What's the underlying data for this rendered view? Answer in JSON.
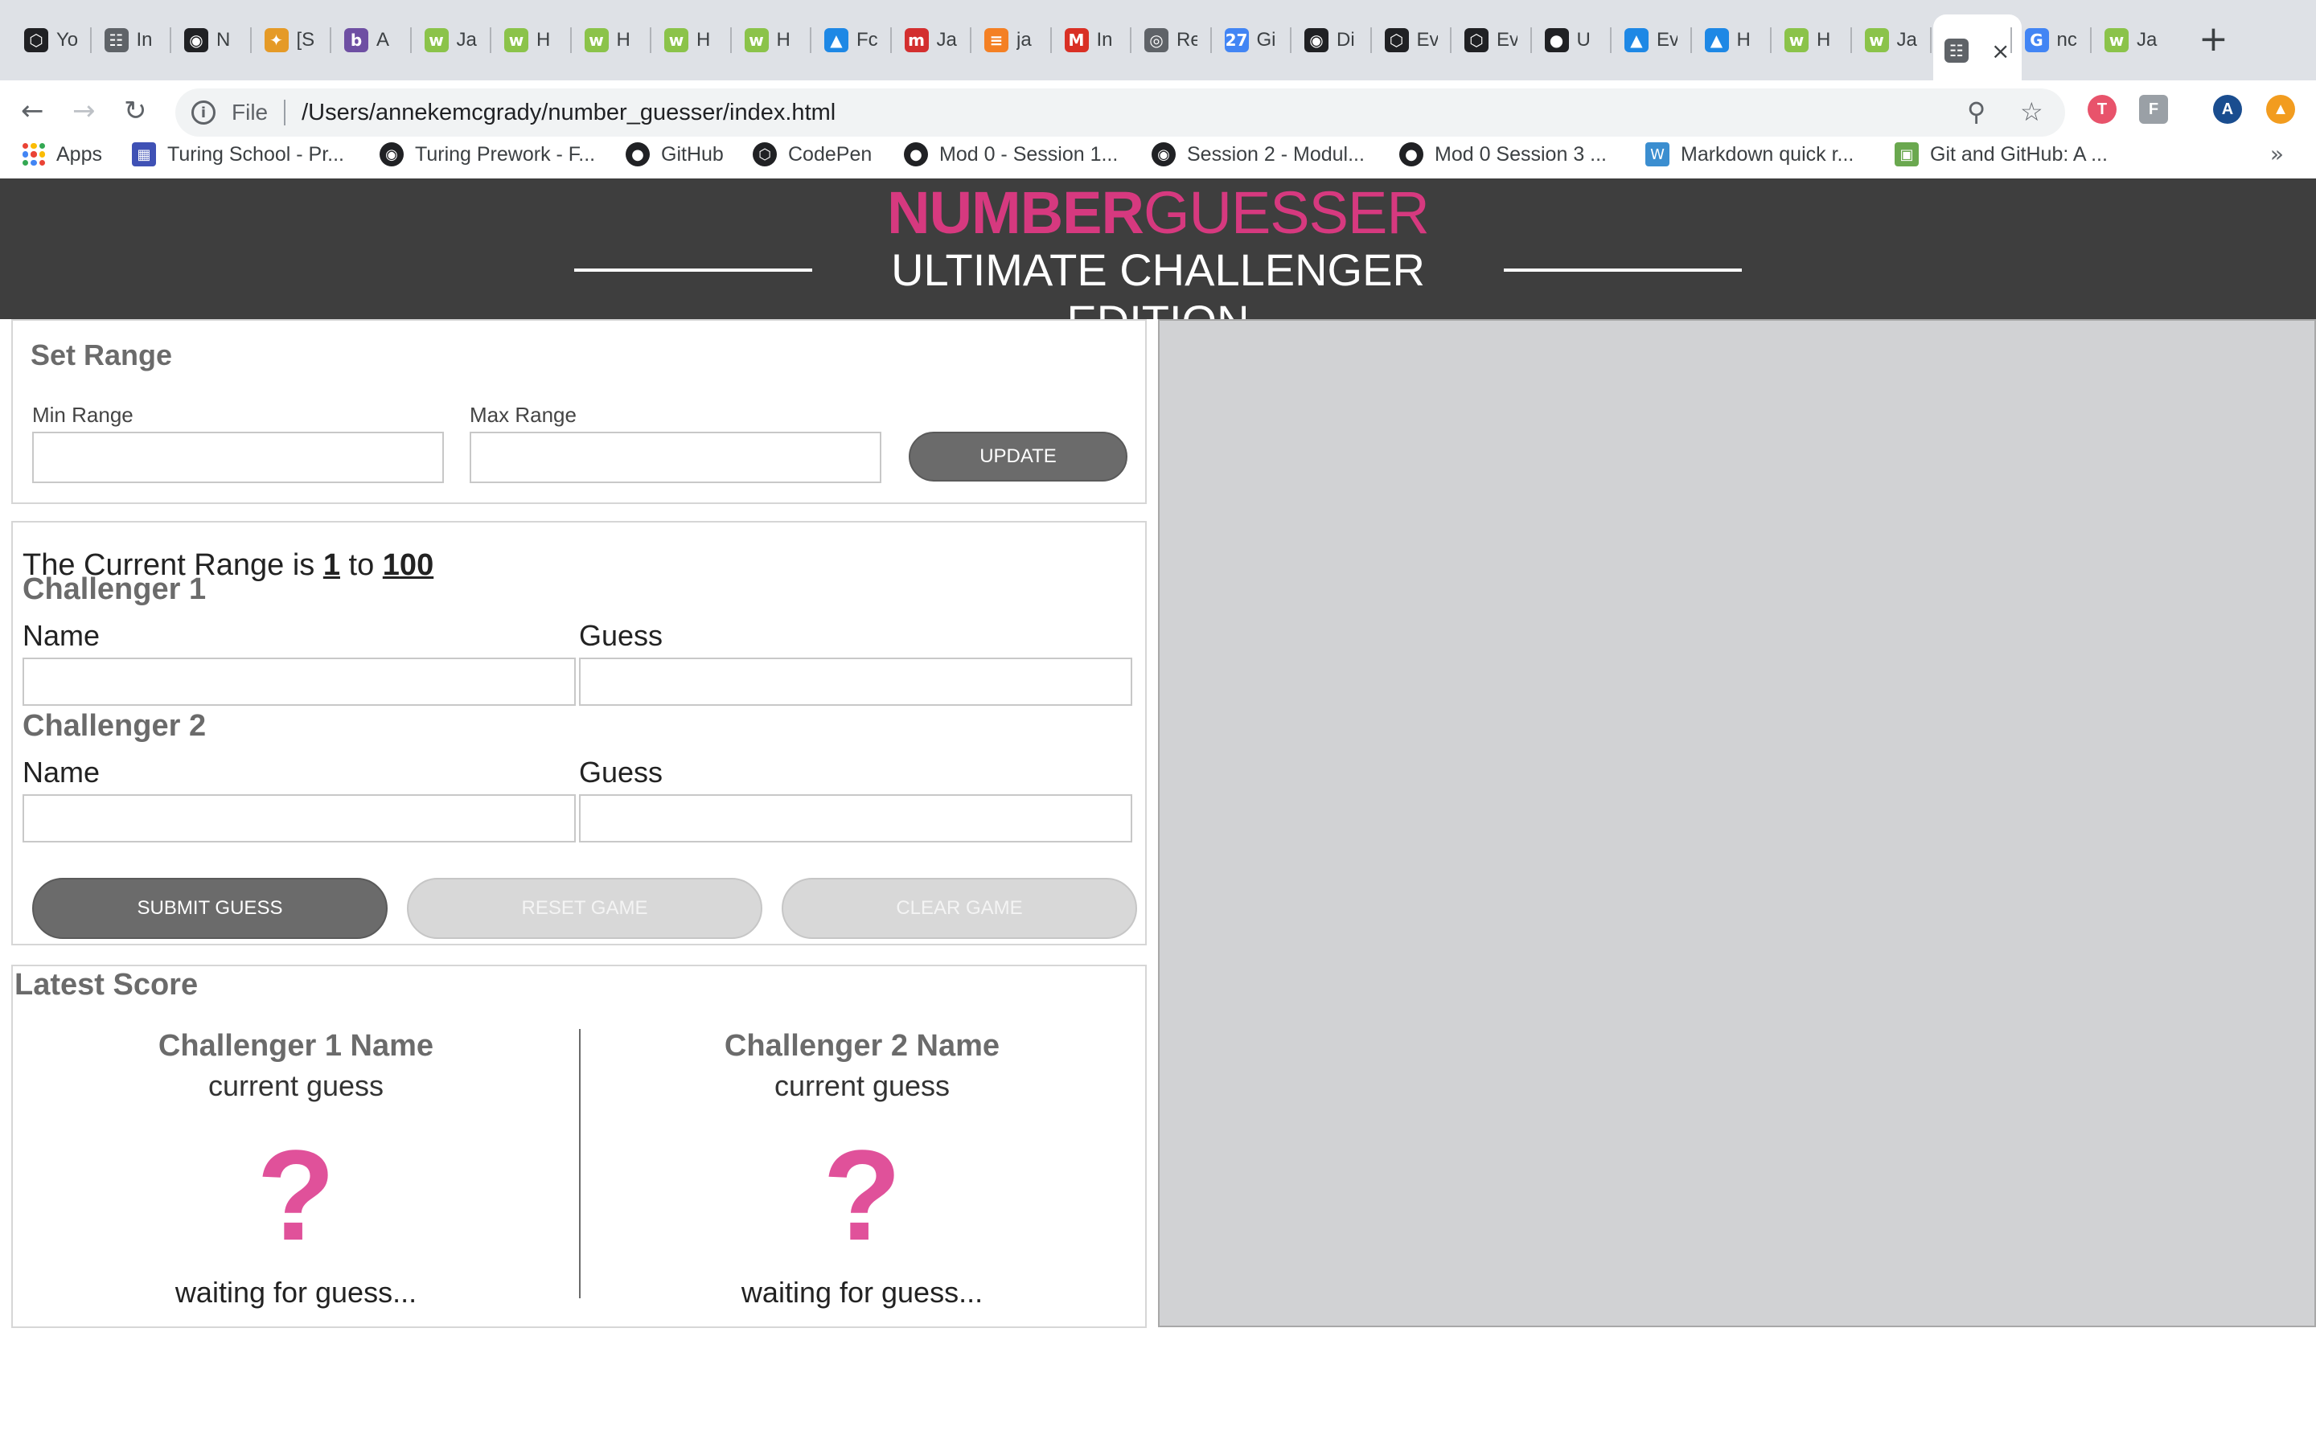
{
  "browser": {
    "tabs": [
      {
        "title": "Yo",
        "icon": "codepen-icon",
        "color": "#202124"
      },
      {
        "title": "In",
        "icon": "document-icon",
        "color": "#5f6368"
      },
      {
        "title": "N",
        "icon": "turing-icon",
        "color": "#202124"
      },
      {
        "title": "[S",
        "icon": "slack-icon",
        "color": "#e59a27"
      },
      {
        "title": "A",
        "icon": "bit-icon",
        "color": "#6e4fa3"
      },
      {
        "title": "Ja",
        "icon": "w3-icon",
        "color": "#8bc34a"
      },
      {
        "title": "H",
        "icon": "w3-icon",
        "color": "#8bc34a"
      },
      {
        "title": "H",
        "icon": "w3-icon",
        "color": "#8bc34a"
      },
      {
        "title": "H",
        "icon": "w3-icon",
        "color": "#8bc34a"
      },
      {
        "title": "H",
        "icon": "w3-icon",
        "color": "#8bc34a"
      },
      {
        "title": "Fc",
        "icon": "bird-icon",
        "color": "#1e88e5"
      },
      {
        "title": "Ja",
        "icon": "mozilla-icon",
        "color": "#d32f2f"
      },
      {
        "title": "ja",
        "icon": "stackoverflow-icon",
        "color": "#f48024"
      },
      {
        "title": "In",
        "icon": "gmail-icon",
        "color": "#d93025"
      },
      {
        "title": "Re",
        "icon": "spiral-icon",
        "color": "#5f6368"
      },
      {
        "title": "Gi",
        "icon": "calendar-icon",
        "color": "#4285f4"
      },
      {
        "title": "Di",
        "icon": "turing-icon",
        "color": "#202124"
      },
      {
        "title": "Ev",
        "icon": "codepen-icon",
        "color": "#202124"
      },
      {
        "title": "Ev",
        "icon": "codepen-icon",
        "color": "#202124"
      },
      {
        "title": "U",
        "icon": "github-icon",
        "color": "#202124"
      },
      {
        "title": "Ev",
        "icon": "bird-icon",
        "color": "#1e88e5"
      },
      {
        "title": "H",
        "icon": "bird-icon",
        "color": "#1e88e5"
      },
      {
        "title": "H",
        "icon": "w3-icon",
        "color": "#8bc34a"
      },
      {
        "title": "Ja",
        "icon": "w3-icon",
        "color": "#8bc34a"
      },
      {
        "title": "",
        "icon": "document-icon",
        "color": "#5f6368",
        "active": true
      },
      {
        "title": "nc",
        "icon": "google-icon",
        "color": "#4285f4"
      },
      {
        "title": "Ja",
        "icon": "w3-icon",
        "color": "#8bc34a"
      }
    ],
    "address": {
      "scheme": "File",
      "url": "/Users/annekemcgrady/number_guesser/index.html"
    },
    "bookmarks": [
      {
        "label": "Apps",
        "icon": "apps-grid-icon"
      },
      {
        "label": "Turing School - Pr...",
        "icon": "turing-school-icon"
      },
      {
        "label": "Turing Prework - F...",
        "icon": "turing-icon"
      },
      {
        "label": "GitHub",
        "icon": "github-icon"
      },
      {
        "label": "CodePen",
        "icon": "codepen-icon"
      },
      {
        "label": "Mod 0 - Session 1...",
        "icon": "github-icon"
      },
      {
        "label": "Session 2 - Modul...",
        "icon": "turing-icon"
      },
      {
        "label": "Mod 0 Session 3 ...",
        "icon": "github-icon"
      },
      {
        "label": "Markdown quick r...",
        "icon": "wordpress-icon"
      },
      {
        "label": "Git and GitHub: A ...",
        "icon": "image-icon"
      }
    ],
    "bookmarks_more": "»",
    "profile_initial": "A"
  },
  "header": {
    "logo_bold": "NUMBER",
    "logo_thin": "GUESSER",
    "edition": "ULTIMATE CHALLENGER EDITION"
  },
  "set_range": {
    "title": "Set Range",
    "min_label": "Min Range",
    "max_label": "Max Range",
    "min_value": "",
    "max_value": "",
    "update_button": "UPDATE"
  },
  "challengers": {
    "range_prefix": "The Current Range is ",
    "range_min": "1",
    "range_joiner": " to ",
    "range_max": "100",
    "c1_title": "Challenger 1",
    "c2_title": "Challenger 2",
    "name_label": "Name",
    "guess_label": "Guess",
    "c1_name": "",
    "c1_guess": "",
    "c2_name": "",
    "c2_guess": "",
    "submit_button": "SUBMIT GUESS",
    "reset_button": "RESET GAME",
    "clear_button": "CLEAR GAME"
  },
  "score": {
    "title": "Latest Score",
    "c1_name": "Challenger 1 Name",
    "c2_name": "Challenger 2 Name",
    "current_guess": "current guess",
    "placeholder_mark": "?",
    "waiting": "waiting for guess..."
  },
  "colors": {
    "accent_pink": "#d6397f",
    "header_bg": "#3e3e3e",
    "right_pane_bg": "#d1d2d4"
  }
}
